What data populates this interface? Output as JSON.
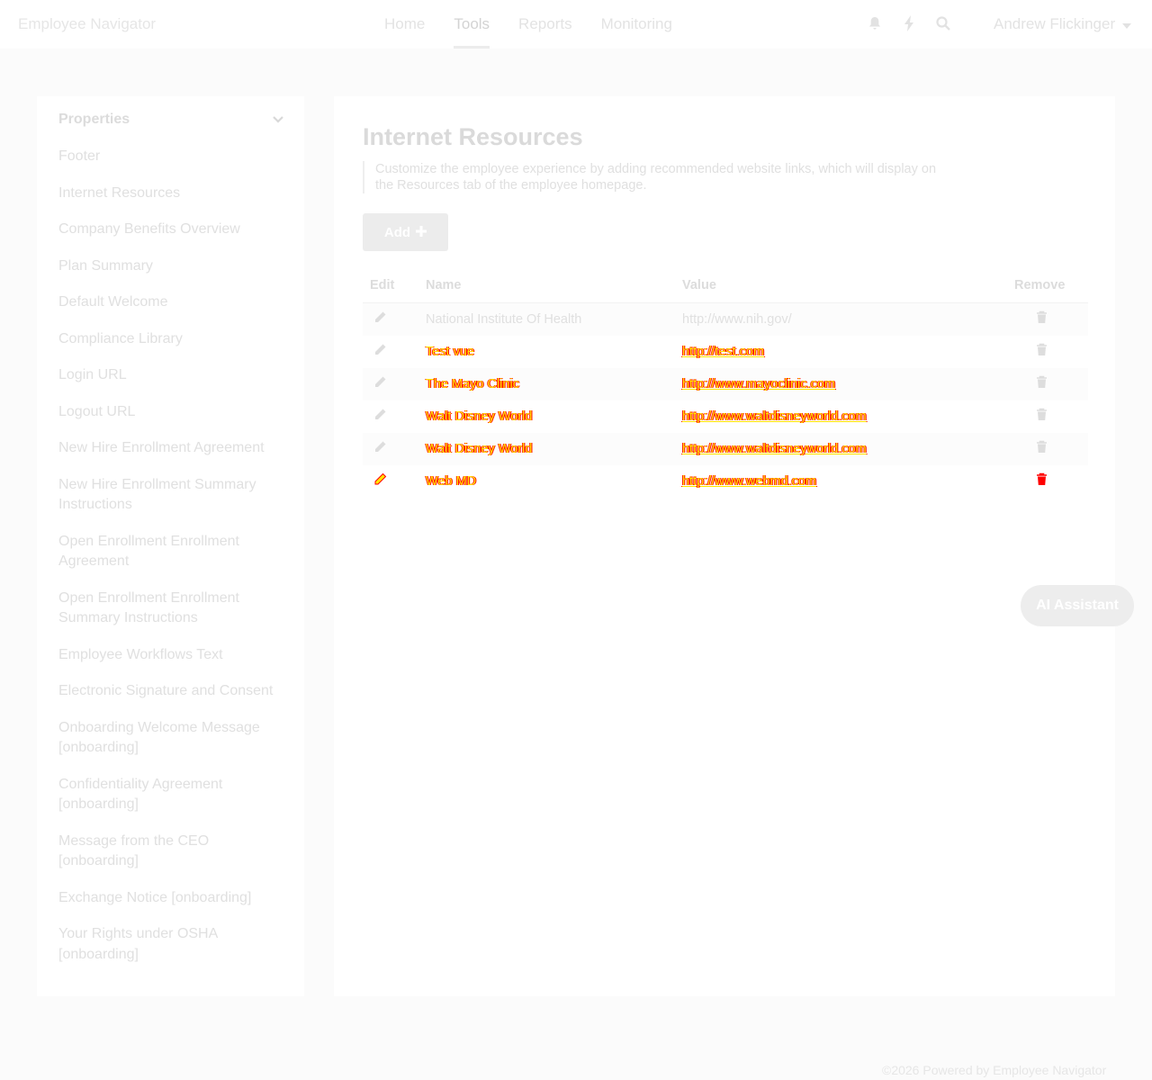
{
  "header": {
    "brand": "Employee Navigator",
    "nav": [
      "Home",
      "Tools",
      "Reports",
      "Monitoring"
    ],
    "active_nav": "Tools",
    "user": "Andrew Flickinger"
  },
  "sidebar": {
    "title": "Properties",
    "items": [
      "Footer",
      "Internet Resources",
      "Company Benefits Overview",
      "Plan Summary",
      "Default Welcome",
      "Compliance Library",
      "Login URL",
      "Logout URL",
      "New Hire Enrollment Agreement",
      "New Hire Enrollment Summary Instructions",
      "Open Enrollment Enrollment Agreement",
      "Open Enrollment Enrollment Summary Instructions",
      "Employee Workflows Text",
      "Electronic Signature and Consent",
      "Onboarding Welcome Message [onboarding]",
      "Confidentiality Agreement [onboarding]",
      "Message from the CEO [onboarding]",
      "Exchange Notice [onboarding]",
      "Your Rights under OSHA [onboarding]"
    ]
  },
  "main": {
    "title": "Internet Resources",
    "description": "Customize the employee experience by adding recommended website links, which will display on the Resources tab of the employee homepage.",
    "add_label": "Add",
    "columns": {
      "edit": "Edit",
      "name": "Name",
      "value": "Value",
      "remove": "Remove"
    },
    "rows": [
      {
        "name": "National Institute Of Health",
        "value": "http://www.nih.gov/",
        "highlight": false
      },
      {
        "name": "Test vue",
        "value": "http://test.com",
        "highlight": true
      },
      {
        "name": "The Mayo Clinic",
        "value": "http://www.mayoclinic.com",
        "highlight": true
      },
      {
        "name": "Walt Disney World",
        "value": "http://www.waltdisneyworld.com",
        "highlight": true
      },
      {
        "name": "Walt Disney World",
        "value": "http://www.waltdisneyworld.com",
        "highlight": true
      },
      {
        "name": "Web MD",
        "value": "http://www.webmd.com",
        "highlight": true
      }
    ]
  },
  "ai_assistant": "AI Assistant",
  "footer": "©2026 Powered by Employee Navigator",
  "colors": {
    "highlight_text": "#ffe400",
    "highlight_outline": "#ff0000"
  },
  "icons": {
    "edit": "pencil-icon",
    "remove": "trash-icon"
  }
}
